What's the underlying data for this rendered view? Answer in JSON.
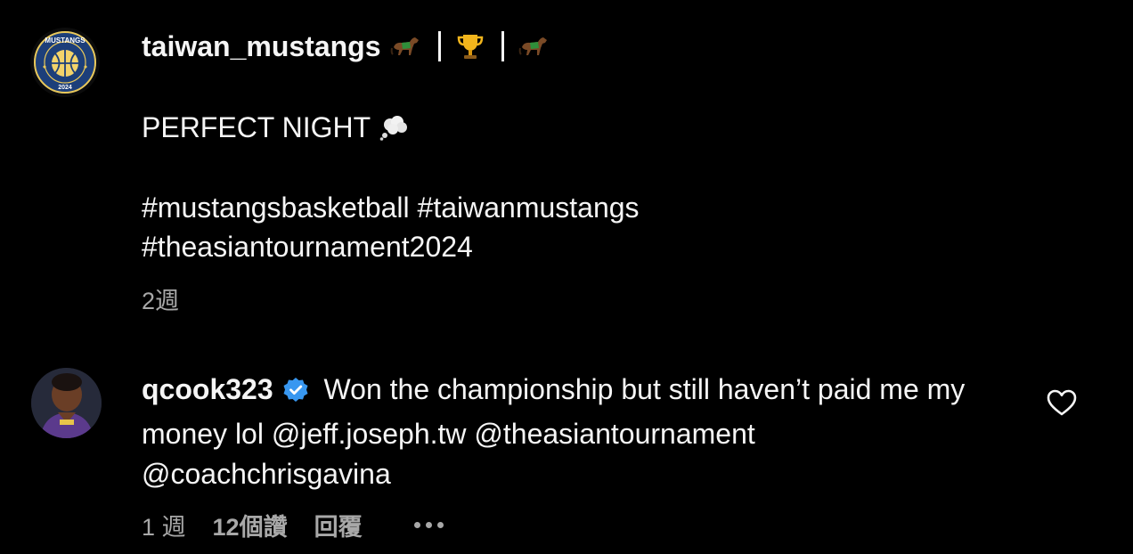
{
  "post": {
    "username": "taiwan_mustangs",
    "header_icons": [
      "horse-icon",
      "trophy-icon",
      "horse-icon"
    ],
    "caption_line1": "PERFECT NIGHT",
    "caption_line1_icon": "thought-bubble-icon",
    "hashtags_line1": "#mustangsbasketball #taiwanmustangs",
    "hashtags_line2": "#theasiantournament2024",
    "time": "2週",
    "avatar_logo_text": "MUSTANGS",
    "avatar_logo_year": "2024"
  },
  "reply": {
    "username": "qcook323",
    "verified_icon": "verified-badge-icon",
    "text_main": " Won the championship but still haven’t paid me my money lol ",
    "mentions": [
      "@jeff.joseph.tw",
      "@theasiantournament",
      "@coachchrisgavina"
    ],
    "time": "1 週",
    "likes": "12個讚",
    "reply_label": "回覆",
    "like_icon": "heart-outline-icon",
    "more_icon": "more-horizontal-icon"
  },
  "colors": {
    "background": "#000000",
    "text": "#f5f5f5",
    "secondary": "#a8a8a8",
    "verified": "#3897f0"
  }
}
